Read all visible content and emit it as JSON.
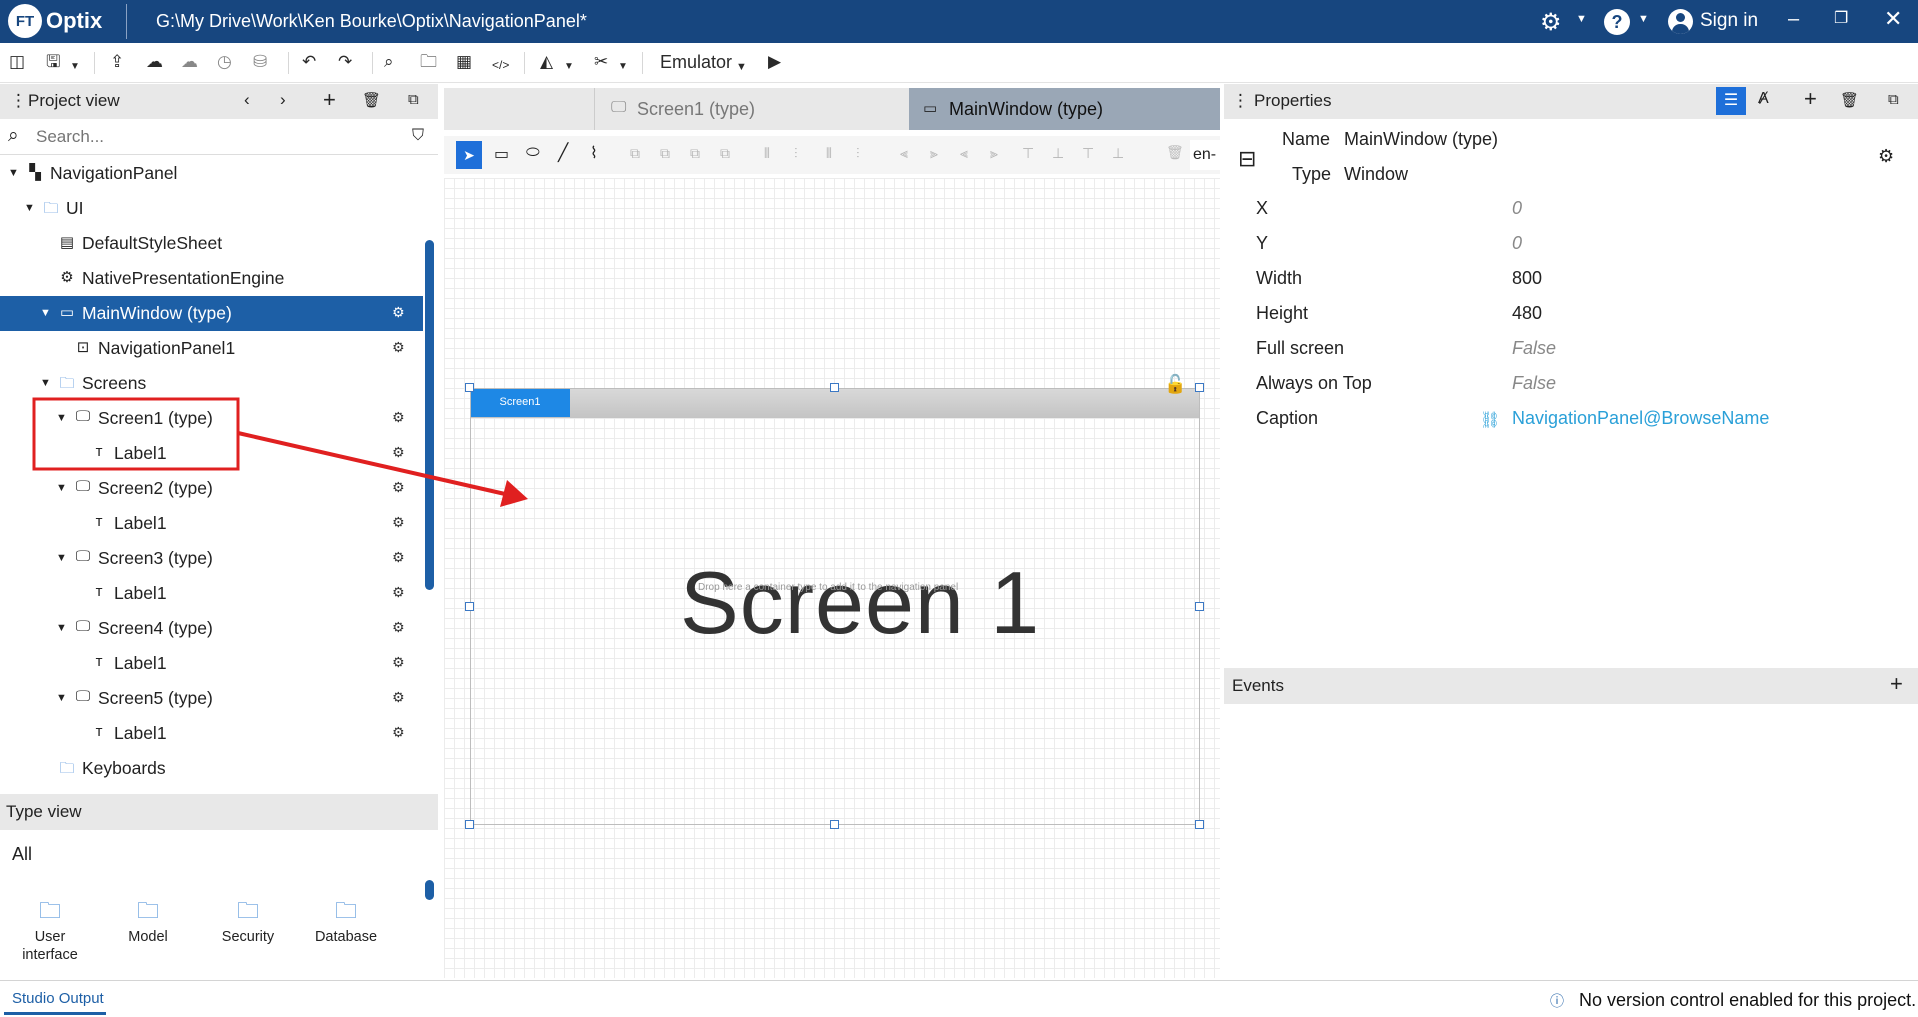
{
  "app": {
    "title": "Optix",
    "badge": "FT",
    "path": "G:\\My Drive\\Work\\Ken Bourke\\Optix\\NavigationPanel*",
    "signin": "Sign in",
    "emulator": "Emulator"
  },
  "colors": {
    "titlebar": "#17467f",
    "selected": "#1d5fa6",
    "accent": "#1e88e5",
    "link": "#2aa0d8",
    "annotation": "#e02020"
  },
  "project_view": {
    "title": "Project view",
    "search_placeholder": "Search...",
    "tree": [
      {
        "label": "NavigationPanel",
        "icon": "project-icon",
        "expanded": true,
        "depth": 0
      },
      {
        "label": "UI",
        "icon": "folder-icon",
        "expanded": true,
        "depth": 1
      },
      {
        "label": "DefaultStyleSheet",
        "icon": "stylesheet-icon",
        "depth": 2
      },
      {
        "label": "NativePresentationEngine",
        "icon": "engine-gear-icon",
        "depth": 2
      },
      {
        "label": "MainWindow (type)",
        "icon": "window-icon",
        "expanded": true,
        "depth": 2,
        "selected": true
      },
      {
        "label": "NavigationPanel1",
        "icon": "navigation-panel-icon",
        "depth": 3
      },
      {
        "label": "Screens",
        "icon": "folder-icon",
        "expanded": true,
        "depth": 2
      },
      {
        "label": "Screen1 (type)",
        "icon": "monitor-icon",
        "expanded": true,
        "depth": 3
      },
      {
        "label": "Label1",
        "icon": "label-icon",
        "depth": 4
      },
      {
        "label": "Screen2 (type)",
        "icon": "monitor-icon",
        "expanded": true,
        "depth": 3
      },
      {
        "label": "Label1",
        "icon": "label-icon",
        "depth": 4
      },
      {
        "label": "Screen3 (type)",
        "icon": "monitor-icon",
        "expanded": true,
        "depth": 3
      },
      {
        "label": "Label1",
        "icon": "label-icon",
        "depth": 4
      },
      {
        "label": "Screen4 (type)",
        "icon": "monitor-icon",
        "expanded": true,
        "depth": 3
      },
      {
        "label": "Label1",
        "icon": "label-icon",
        "depth": 4
      },
      {
        "label": "Screen5 (type)",
        "icon": "monitor-icon",
        "expanded": true,
        "depth": 3
      },
      {
        "label": "Label1",
        "icon": "label-icon",
        "depth": 4
      },
      {
        "label": "Keyboards",
        "icon": "folder-icon",
        "depth": 2
      }
    ]
  },
  "type_view": {
    "title": "Type view",
    "filter": "All",
    "items": [
      {
        "label": "User\ninterface",
        "icon": "ui-folder-icon"
      },
      {
        "label": "Model",
        "icon": "model-folder-icon"
      },
      {
        "label": "Security",
        "icon": "security-folder-icon"
      },
      {
        "label": "Database",
        "icon": "database-folder-icon"
      }
    ]
  },
  "editor": {
    "tabs": [
      {
        "label": "Screen1 (type)",
        "active": false
      },
      {
        "label": "MainWindow (type)",
        "active": true
      }
    ],
    "lang": "en-",
    "nav_tab": "Screen1",
    "canvas_text": "Screen 1",
    "hint": "Drop here a container type to add it to the navigation panel"
  },
  "properties": {
    "title": "Properties",
    "name_label": "Name",
    "name_value": "MainWindow (type)",
    "type_label": "Type",
    "type_value": "Window",
    "rows": [
      {
        "label": "X",
        "value": "0",
        "italic": true
      },
      {
        "label": "Y",
        "value": "0",
        "italic": true
      },
      {
        "label": "Width",
        "value": "800"
      },
      {
        "label": "Height",
        "value": "480"
      },
      {
        "label": "Full screen",
        "value": "False",
        "italic": true
      },
      {
        "label": "Always on Top",
        "value": "False",
        "italic": true
      },
      {
        "label": "Caption",
        "value": "NavigationPanel@BrowseName",
        "link": true
      }
    ]
  },
  "events": {
    "title": "Events"
  },
  "status": {
    "tab": "Studio Output",
    "message": "No version control enabled for this project."
  }
}
